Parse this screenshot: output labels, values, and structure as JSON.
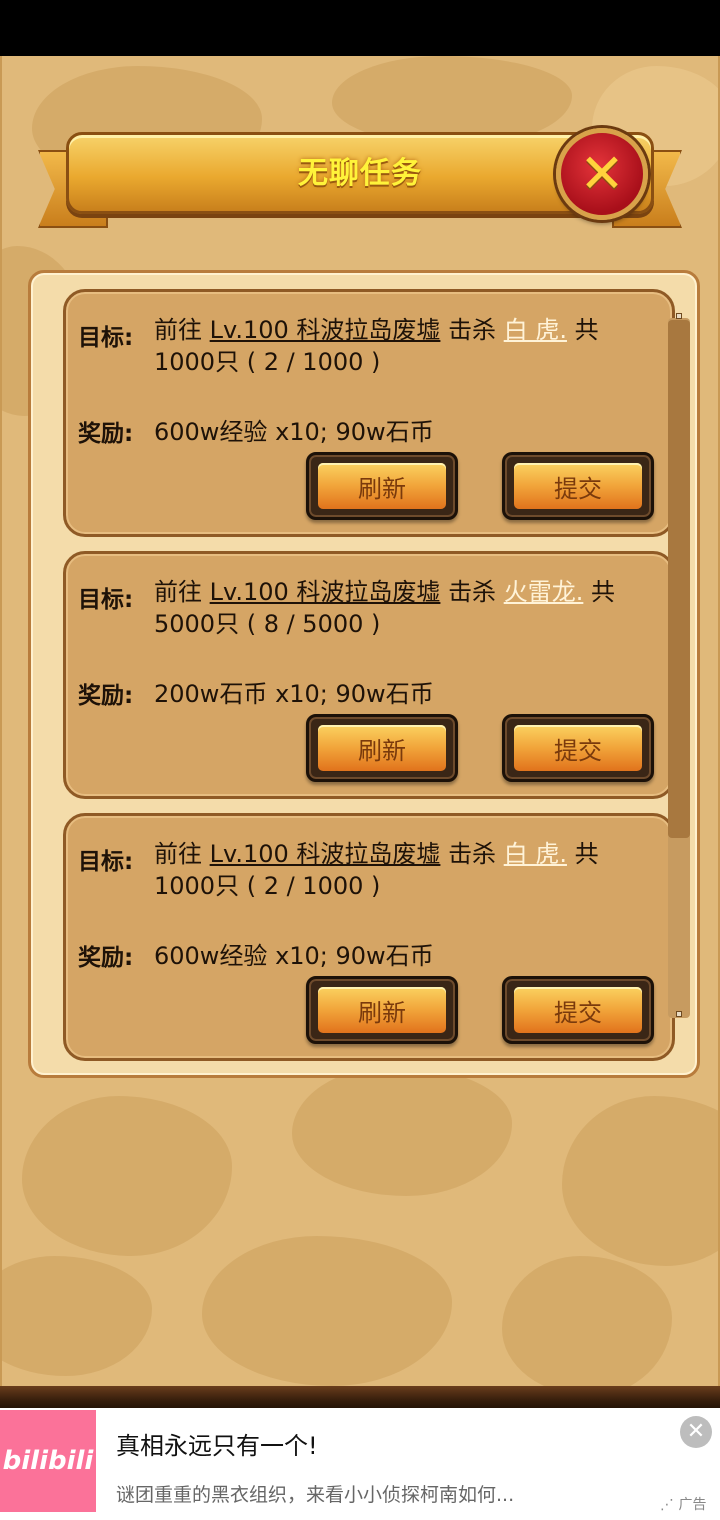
{
  "dialog": {
    "title": "无聊任务",
    "close_icon": "close-x-icon"
  },
  "labels": {
    "goal": "目标:",
    "reward": "奖励:",
    "refresh": "刷新",
    "submit": "提交"
  },
  "tasks": [
    {
      "prefix": "前往",
      "location": "Lv.100 科波拉岛废墟",
      "verb": "击杀",
      "target": "白 虎.",
      "suffix": "共1000只 ( 2 / 1000 )",
      "reward": "600w经验 x10; 90w石币"
    },
    {
      "prefix": "前往",
      "location": "Lv.100 科波拉岛废墟",
      "verb": "击杀",
      "target": "火雷龙.",
      "suffix": "共5000只 ( 8 / 5000 )",
      "reward": "200w石币 x10; 90w石币"
    },
    {
      "prefix": "前往",
      "location": "Lv.100 科波拉岛废墟",
      "verb": "击杀",
      "target": "白 虎.",
      "suffix": "共1000只 ( 2 / 1000 )",
      "reward": "600w经验 x10; 90w石币"
    }
  ],
  "ad": {
    "logo_text": "bilibili",
    "title": "真相永远只有一个!",
    "description": "谜团重重的黑衣组织，来看小小侦探柯南如何...",
    "tag": "广告",
    "close_icon": "close-icon"
  }
}
